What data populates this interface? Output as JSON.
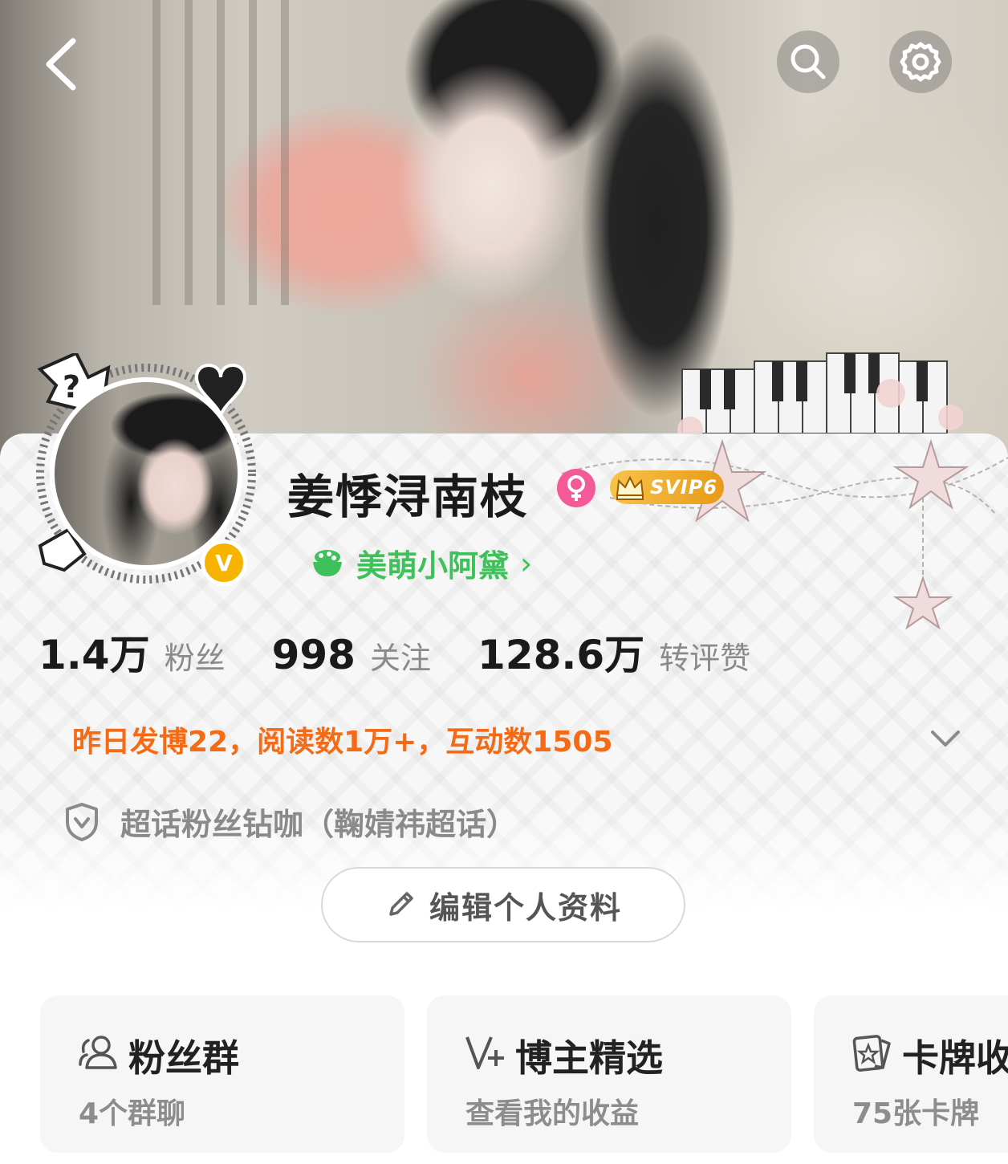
{
  "header": {
    "back_icon": "back-arrow-icon",
    "search_icon": "search-icon",
    "settings_icon": "gear-icon"
  },
  "profile": {
    "nickname": "姜悸浔南枝",
    "gender_icon": "female-icon",
    "vip_badge": "SVIP6",
    "verified_badge": "V",
    "fan_title": "美萌小阿黛",
    "fan_title_chevron": "›"
  },
  "stats": [
    {
      "value": "1.4万",
      "label": "粉丝"
    },
    {
      "value": "998",
      "label": "关注"
    },
    {
      "value": "128.6万",
      "label": "转评赞"
    }
  ],
  "activity": {
    "text": "昨日发博22，阅读数1万+，互动数1505"
  },
  "badge": {
    "text": "超话粉丝钻咖（鞠婧祎超话）"
  },
  "edit_button": {
    "label": "编辑个人资料"
  },
  "cards": [
    {
      "title": "粉丝群",
      "subtitle": "4个群聊",
      "icon": "group-icon"
    },
    {
      "title": "博主精选",
      "subtitle": "查看我的收益",
      "icon": "v-plus-icon"
    },
    {
      "title": "卡牌收藏",
      "subtitle": "75张卡牌",
      "icon": "card-icon"
    }
  ],
  "colors": {
    "accent_orange": "#f56a14",
    "fan_green": "#3ec05a",
    "verified_yellow": "#f6b400",
    "gender_pink": "#f45a9a",
    "svip_gold": "#e79a18"
  }
}
